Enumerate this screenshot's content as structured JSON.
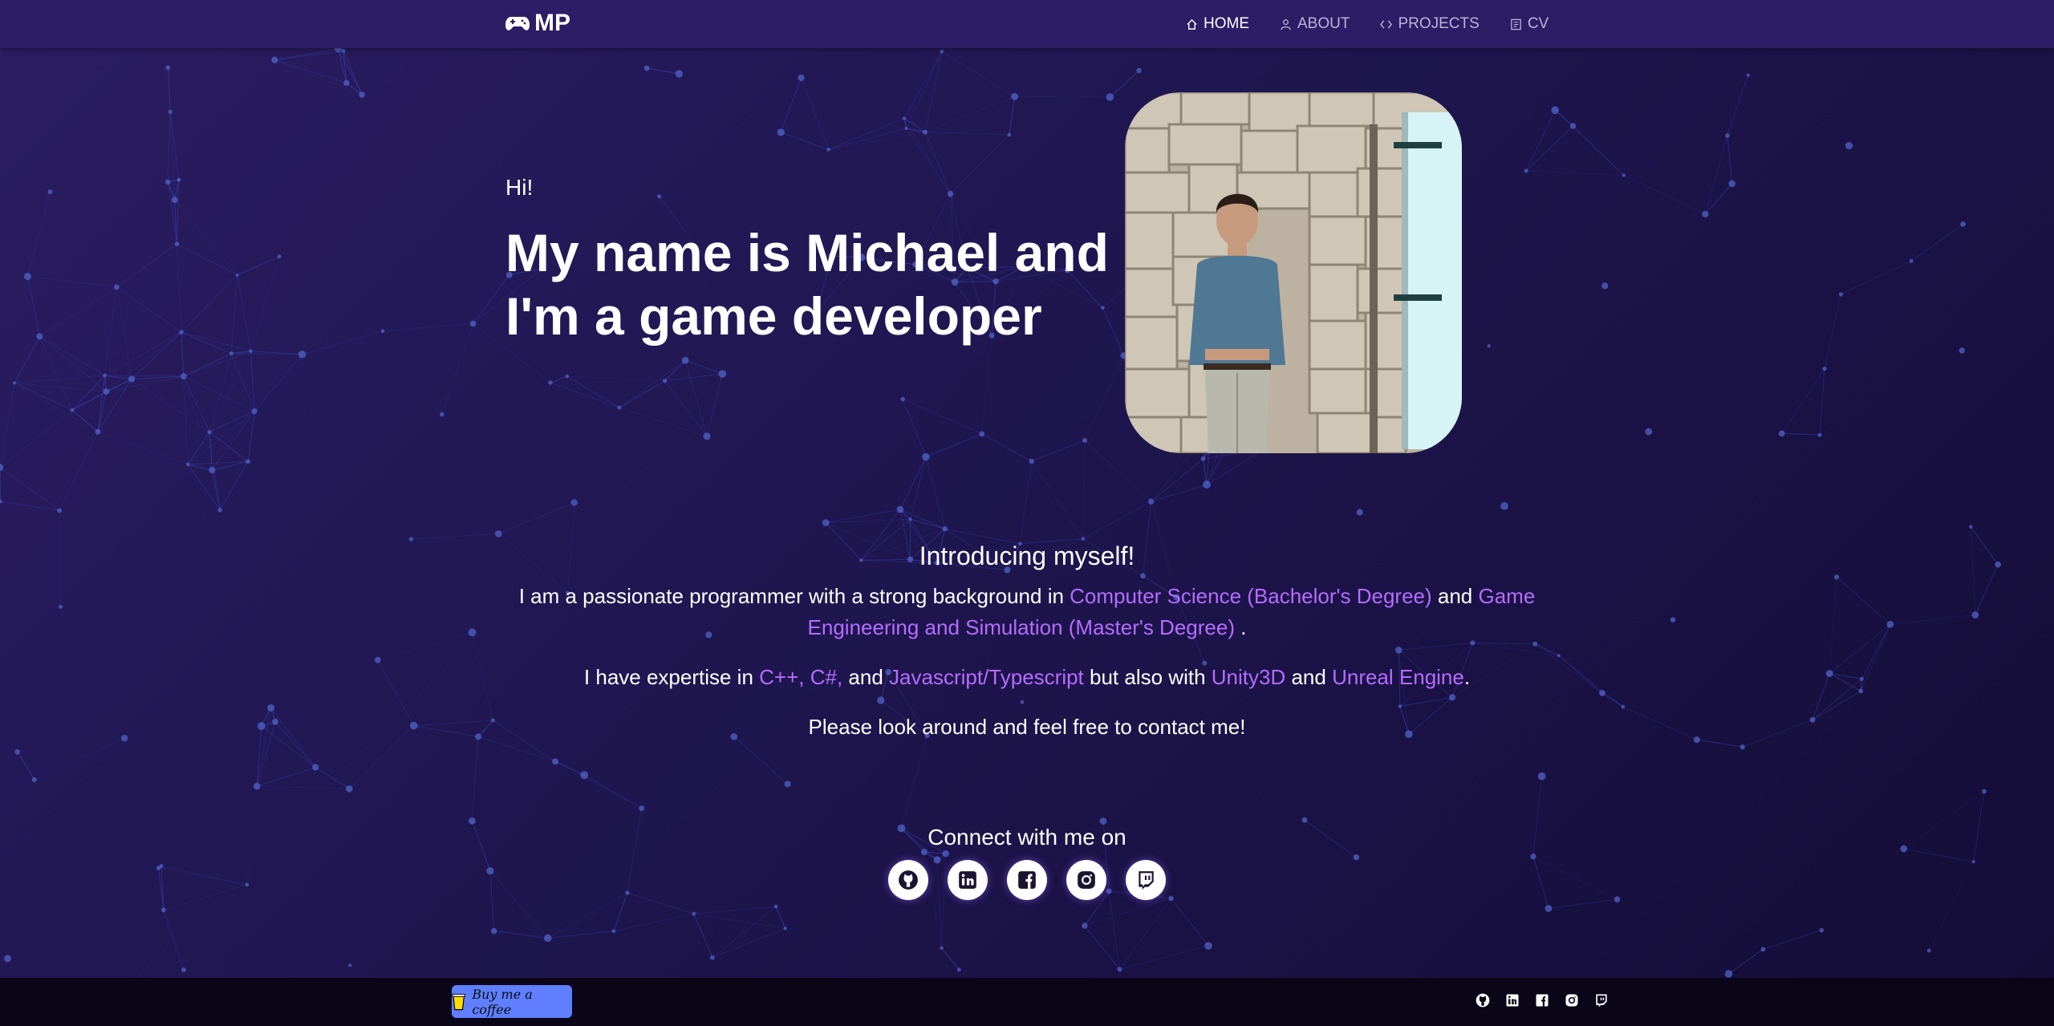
{
  "nav": {
    "brand": "MP",
    "items": [
      {
        "label": "HOME",
        "icon": "home-icon",
        "active": true
      },
      {
        "label": "ABOUT",
        "icon": "user-icon",
        "active": false
      },
      {
        "label": "PROJECTS",
        "icon": "code-icon",
        "active": false
      },
      {
        "label": "CV",
        "icon": "document-icon",
        "active": false
      }
    ]
  },
  "hero": {
    "greeting": "Hi!",
    "headline_line1": "My name is Michael and",
    "headline_line2": "I'm a game developer"
  },
  "intro": {
    "title": "Introducing myself!",
    "p1_start": "I am a passionate programmer with a strong background in ",
    "p1_hl1": "Computer Science (Bachelor's Degree)",
    "p1_mid": " and ",
    "p1_hl2": "Game Engineering and Simulation (Master's Degree)",
    "p1_end": " .",
    "p2_start": "I have expertise in ",
    "p2_hl1": "C++, C#,",
    "p2_mid1": " and ",
    "p2_hl2": "Javascript/Typescript",
    "p2_mid2": " but also with ",
    "p2_hl3": "Unity3D",
    "p2_mid3": " and ",
    "p2_hl4": "Unreal Engine",
    "p2_end": ".",
    "p3": "Please look around and feel free to contact me!"
  },
  "connect": {
    "title": "Connect with me on",
    "links": [
      "github-icon",
      "linkedin-icon",
      "facebook-icon",
      "instagram-icon",
      "twitch-icon"
    ]
  },
  "footer": {
    "coffee_label": "Buy me a coffee"
  },
  "colors": {
    "accent": "#b56cff",
    "navbar": "#2b1d66",
    "background": "#211755",
    "footer": "#0a0618",
    "coffee_button": "#5f7fff"
  }
}
